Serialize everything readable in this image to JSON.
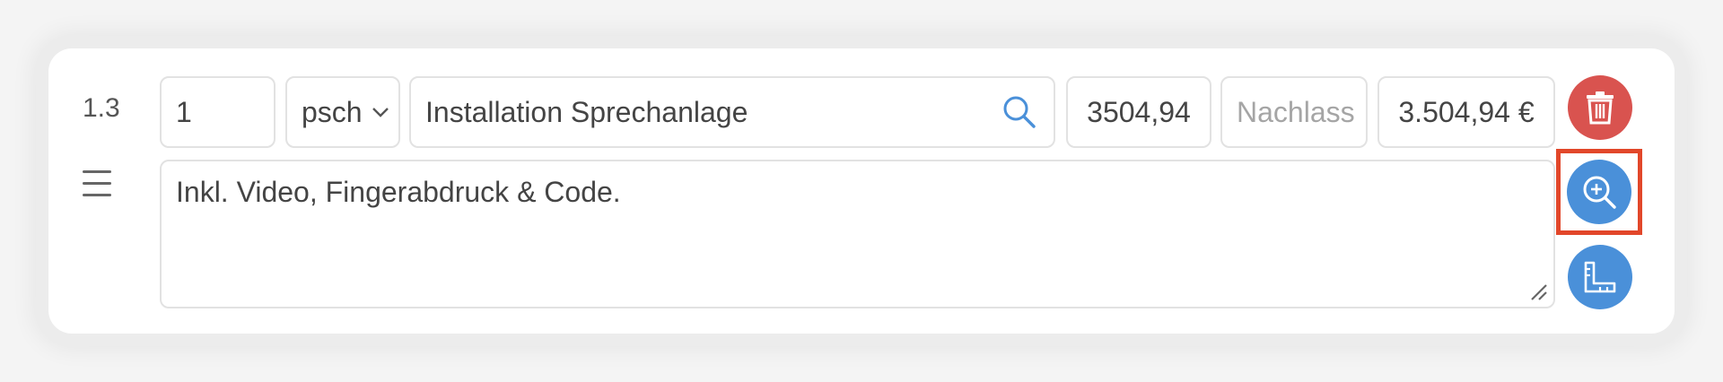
{
  "row": {
    "position": "1.3",
    "quantity": "1",
    "unit": "psch",
    "description": "Installation Sprechanlage",
    "unit_price": "3504,94",
    "discount_placeholder": "Nachlass",
    "total": "3.504,94 €",
    "long_text": "Inkl. Video, Fingerabdruck & Code."
  },
  "colors": {
    "delete": "#d9534f",
    "action": "#4a90d9",
    "highlight": "#e2472a"
  },
  "icons": [
    "drag-handle-icon",
    "chevron-down-icon",
    "search-icon",
    "trash-icon",
    "zoom-in-icon",
    "ruler-icon",
    "resize-icon"
  ]
}
